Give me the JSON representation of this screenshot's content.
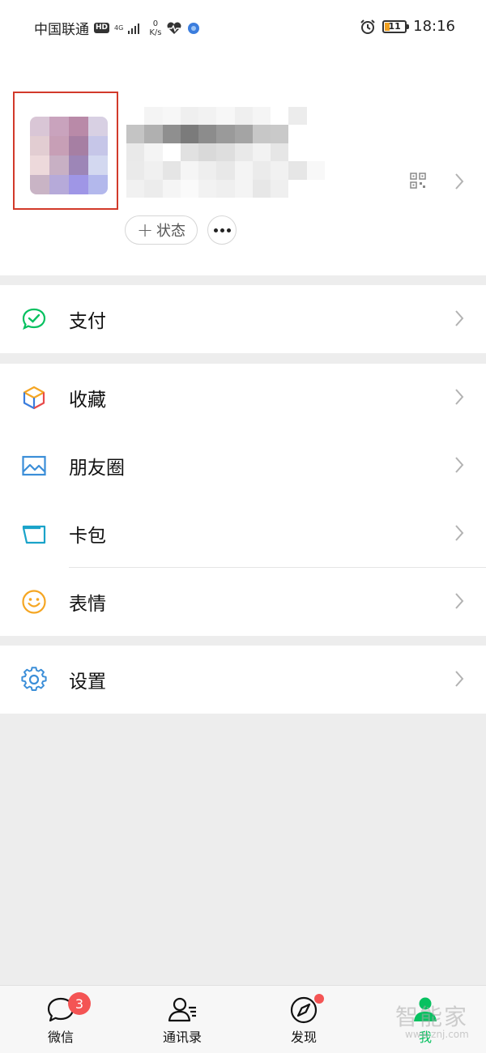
{
  "status_bar": {
    "carrier": "中国联通",
    "hd": "HD",
    "network": "4G",
    "speed_value": "0",
    "speed_unit": "K/s",
    "battery_level": "11",
    "time": "18:16"
  },
  "profile": {
    "status_label": "状态"
  },
  "groups": {
    "pay": {
      "label": "支付"
    },
    "collections": {
      "label": "收藏"
    },
    "moments": {
      "label": "朋友圈"
    },
    "cards": {
      "label": "卡包"
    },
    "stickers": {
      "label": "表情"
    },
    "settings": {
      "label": "设置"
    }
  },
  "bottom_nav": {
    "chats": {
      "label": "微信",
      "badge": "3"
    },
    "contacts": {
      "label": "通讯录"
    },
    "discover": {
      "label": "发现"
    },
    "me": {
      "label": "我"
    }
  },
  "watermark": {
    "text": "智能家",
    "url": "www.znj.com"
  },
  "colors": {
    "accent_green": "#07c160",
    "badge_red": "#f45454",
    "highlight_red": "#d23a2a",
    "background": "#ededed"
  },
  "icons": {
    "pay": "wallet-check-icon",
    "collections": "cube-icon",
    "moments": "picture-icon",
    "cards": "card-wallet-icon",
    "stickers": "smiley-icon",
    "settings": "gear-icon"
  }
}
